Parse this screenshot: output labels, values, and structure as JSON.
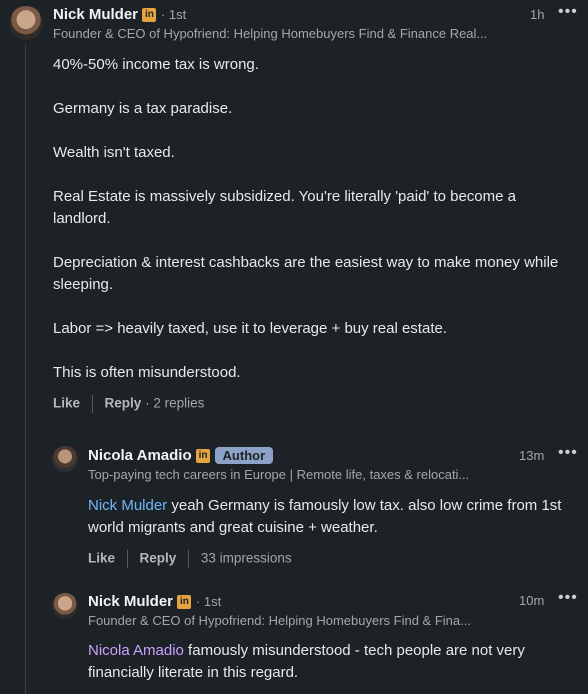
{
  "comments": [
    {
      "author": "Nick Mulder",
      "linkedin_badge": "in",
      "degree": "· 1st",
      "headline": "Founder & CEO of Hypofriend: Helping Homebuyers Find & Finance Real...",
      "time": "1h",
      "menu": "•••",
      "paragraphs": [
        "40%-50% income tax is wrong.",
        "Germany is a tax paradise.",
        "Wealth isn't taxed.",
        "Real Estate is massively subsidized. You're literally 'paid' to become a landlord.",
        "Depreciation & interest cashbacks are the easiest way to make money while sleeping.",
        "Labor => heavily taxed, use it to leverage + buy real estate.",
        "This is often misunderstood."
      ],
      "actions": {
        "like": "Like",
        "reply": "Reply",
        "replies": "· 2 replies"
      }
    }
  ],
  "replies": [
    {
      "author": "Nicola Amadio",
      "linkedin_badge": "in",
      "badge": "Author",
      "headline": "Top-paying tech careers in Europe | Remote life, taxes & relocati...",
      "time": "13m",
      "menu": "•••",
      "mention": "Nick Mulder",
      "text": " yeah Germany is famously low tax. also low crime from 1st world migrants and great cuisine + weather.",
      "actions": {
        "like": "Like",
        "reply": "Reply",
        "impressions": "33 impressions"
      }
    },
    {
      "author": "Nick Mulder",
      "linkedin_badge": "in",
      "degree": "· 1st",
      "headline": "Founder & CEO of Hypofriend: Helping Homebuyers Find & Fina...",
      "time": "10m",
      "menu": "•••",
      "mention": "Nicola Amadio",
      "text": " famously misunderstood - tech people are not very financially literate in this regard."
    }
  ],
  "colors": {
    "background": "#1d2226",
    "mention_blue": "#71b7fb",
    "mention_purple": "#c9a0ff",
    "linkedin_badge": "#e7a33e",
    "author_badge": "#8ca3c7"
  }
}
